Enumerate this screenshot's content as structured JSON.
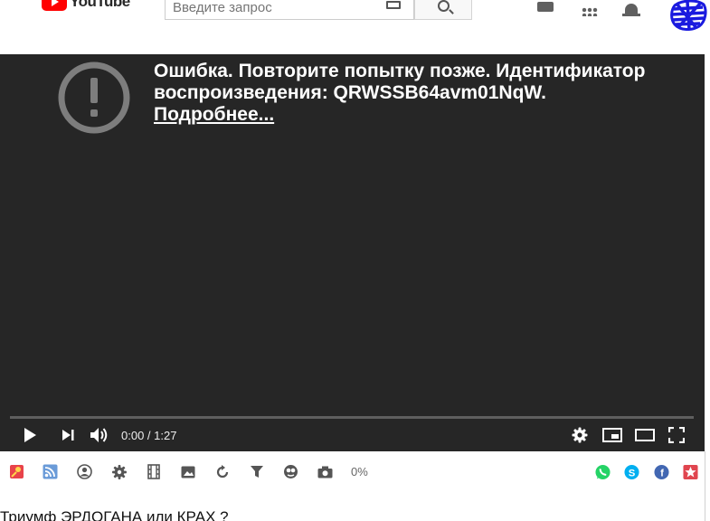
{
  "header": {
    "logo_text": "YouTube",
    "search_placeholder": "Введите запрос"
  },
  "player": {
    "error_message": "Ошибка. Повторите попытку позже. Идентификатор воспроизведения: QRWSSB64avm01NqW.",
    "error_link": "Подробнее...",
    "time_display": "0:00 / 1:27",
    "progress_fraction": 0
  },
  "extension_bar": {
    "percent_label": "0%",
    "left_icons": [
      "pin-icon",
      "rss-icon",
      "user-circle-icon",
      "gear-icon",
      "film-icon",
      "image-icon",
      "refresh-icon",
      "filter-icon",
      "eye-icon",
      "camera-icon"
    ],
    "right_icons": [
      "whatsapp-icon",
      "skype-icon",
      "facebook-icon",
      "star-icon"
    ]
  },
  "video": {
    "title": "Триумф ЭРДОГАНА или КРАХ ?"
  },
  "colors": {
    "player_bg": "#262626",
    "brand_red": "#ff0000",
    "whatsapp": "#25d366",
    "skype": "#00aff0",
    "facebook": "#4267b2",
    "star": "#e0454f"
  }
}
